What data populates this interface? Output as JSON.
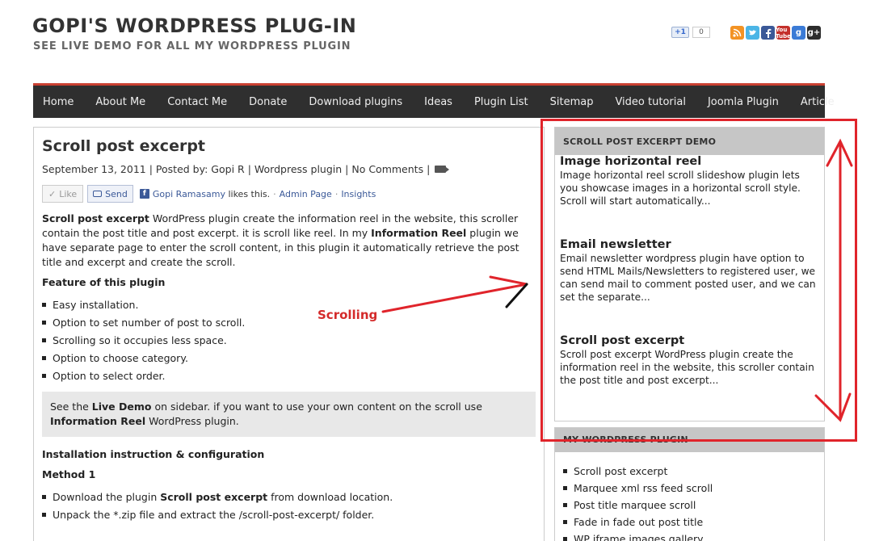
{
  "header": {
    "title": "GOPI'S WORDPRESS PLUG-IN",
    "tagline": "SEE LIVE DEMO FOR ALL MY WORDPRESS PLUGIN",
    "gplus_label": "+1",
    "gplus_count": "0",
    "social_icons": [
      "rss-icon",
      "twitter-icon",
      "facebook-icon",
      "youtube-icon",
      "google-icon",
      "google-plus-icon"
    ],
    "youtube_text": "You Tube",
    "google_text": "g",
    "google_plus_text": "g+"
  },
  "nav": {
    "items": [
      "Home",
      "About Me",
      "Contact Me",
      "Donate",
      "Download plugins",
      "Ideas",
      "Plugin List",
      "Sitemap",
      "Video tutorial",
      "Joomla Plugin",
      "Article"
    ]
  },
  "post": {
    "title": "Scroll post excerpt",
    "date": "September 13, 2011",
    "sep": "|",
    "posted_by_label": "Posted by:",
    "author": "Gopi R",
    "category": "Wordpress plugin",
    "comments": "No Comments",
    "fb": {
      "like": "Like",
      "send": "Send",
      "user": "Gopi Ramasamy",
      "likes_this": "likes this.",
      "dot": "·",
      "admin_page": "Admin Page",
      "insights": "Insights"
    },
    "intro_bold1": "Scroll post excerpt",
    "intro_text1": " WordPress plugin create the information reel in the website, this scroller contain the post title and post excerpt. it is scroll like reel. In my ",
    "intro_bold2": "Information Reel",
    "intro_text2": " plugin we have separate page to enter the scroll content, in this plugin it automatically retrieve the post title and excerpt and create the scroll.",
    "features_heading": "Feature of this plugin",
    "features": [
      "Easy installation.",
      "Option to set number of post to scroll.",
      "Scrolling so it occupies less space.",
      "Option to choose category.",
      "Option to select order."
    ],
    "note_text1": "See the ",
    "note_bold1": "Live Demo",
    "note_text2": " on sidebar. if you want to use your own content on the scroll use ",
    "note_bold2": "Information Reel",
    "note_text3": " WordPress plugin.",
    "install_heading": "Installation instruction & configuration",
    "method_heading": "Method 1",
    "step1_text1": "Download the plugin ",
    "step1_bold": "Scroll post excerpt",
    "step1_text2": " from download location.",
    "step2": "Unpack the *.zip file and extract the /scroll-post-excerpt/ folder."
  },
  "annotation": {
    "label": "Scrolling"
  },
  "sidebar": {
    "demo_heading": "SCROLL POST EXCERPT DEMO",
    "demo_items": [
      {
        "title": "Image horizontal reel",
        "text": "Image horizontal reel scroll slideshow plugin lets you showcase images in a horizontal scroll style. Scroll will start automatically..."
      },
      {
        "title": "Email newsletter",
        "text": "Email newsletter wordpress plugin have option to send HTML Mails/Newsletters to registered user, we can send mail to comment posted user, and we can set the separate..."
      },
      {
        "title": "Scroll post excerpt",
        "text": "Scroll post excerpt WordPress plugin create the information reel in the website, this scroller contain the post title and post excerpt..."
      }
    ],
    "plugins_heading": "MY WORDPRESS PLUGIN",
    "plugins": [
      "Scroll post excerpt",
      "Marquee xml rss feed scroll",
      "Post title marquee scroll",
      "Fade in fade out post title",
      "WP iframe images gallery"
    ]
  },
  "colors": {
    "nav_bg": "#2f2f2f",
    "nav_accent": "#c94031",
    "annotation_red": "#e0242b",
    "widget_head": "#c6c6c6"
  }
}
